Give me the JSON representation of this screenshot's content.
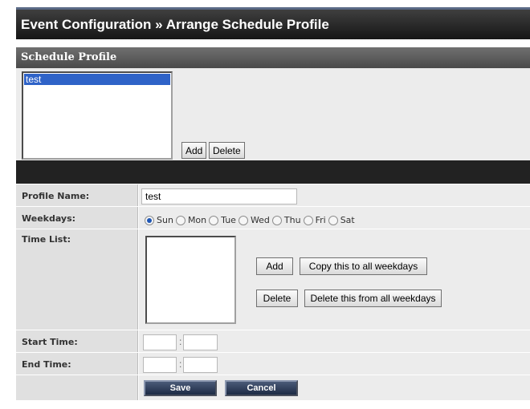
{
  "page": {
    "title": "Event Configuration » Arrange Schedule Profile"
  },
  "schedule_profile": {
    "heading": "Schedule Profile",
    "profiles": [
      "test"
    ],
    "add_label": "Add",
    "delete_label": "Delete"
  },
  "form": {
    "profile_name_label": "Profile Name:",
    "profile_name_value": "test",
    "weekdays_label": "Weekdays:",
    "weekdays": [
      {
        "label": "Sun",
        "selected": true
      },
      {
        "label": "Mon",
        "selected": false
      },
      {
        "label": "Tue",
        "selected": false
      },
      {
        "label": "Wed",
        "selected": false
      },
      {
        "label": "Thu",
        "selected": false
      },
      {
        "label": "Fri",
        "selected": false
      },
      {
        "label": "Sat",
        "selected": false
      }
    ],
    "time_list_label": "Time List:",
    "time_add_label": "Add",
    "copy_all_label": "Copy this to all weekdays",
    "time_delete_label": "Delete",
    "delete_all_label": "Delete this from all weekdays",
    "start_time_label": "Start Time:",
    "end_time_label": "End Time:",
    "time_separator": ":",
    "start_hour": "",
    "start_minute": "",
    "end_hour": "",
    "end_minute": ""
  },
  "footer": {
    "save_label": "Save",
    "cancel_label": "Cancel"
  }
}
